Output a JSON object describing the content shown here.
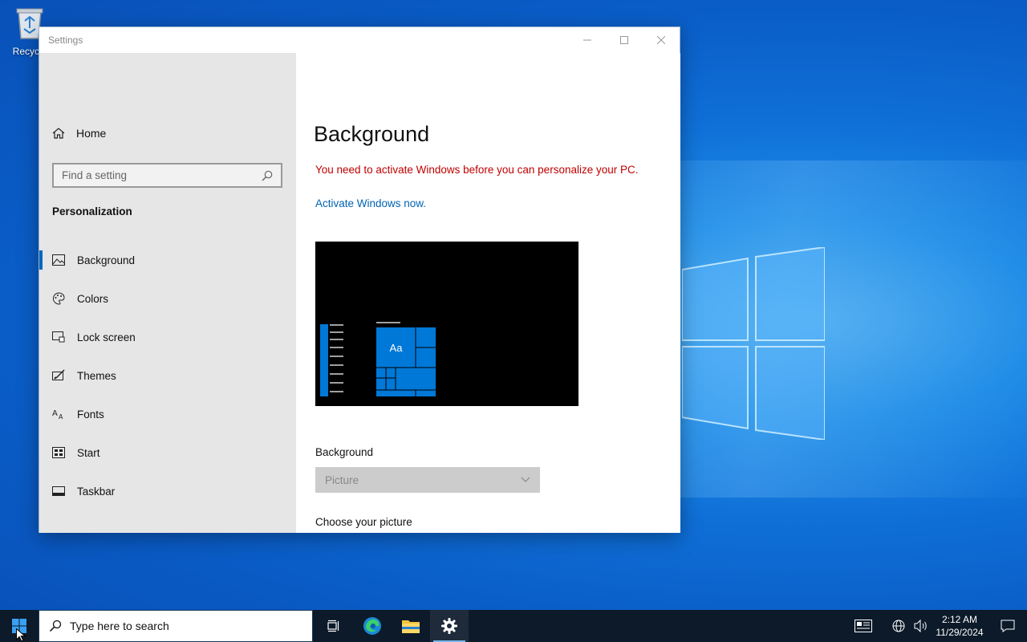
{
  "desktop": {
    "recycle_bin_label": "Recycle"
  },
  "window": {
    "title": "Settings",
    "minimize": "—",
    "maximize": "☐",
    "close": "✕"
  },
  "sidebar": {
    "home_label": "Home",
    "search_placeholder": "Find a setting",
    "section_title": "Personalization",
    "items": [
      {
        "label": "Background",
        "icon": "picture-icon",
        "active": true
      },
      {
        "label": "Colors",
        "icon": "palette-icon"
      },
      {
        "label": "Lock screen",
        "icon": "lock-screen-icon"
      },
      {
        "label": "Themes",
        "icon": "themes-icon"
      },
      {
        "label": "Fonts",
        "icon": "fonts-icon"
      },
      {
        "label": "Start",
        "icon": "start-icon"
      },
      {
        "label": "Taskbar",
        "icon": "taskbar-icon"
      }
    ]
  },
  "main": {
    "heading": "Background",
    "warning": "You need to activate Windows before you can personalize your PC.",
    "activate_link": "Activate Windows now.",
    "preview_tile_text": "Aa",
    "background_label": "Background",
    "background_value": "Picture",
    "choose_label": "Choose your picture"
  },
  "taskbar": {
    "search_placeholder": "Type here to search",
    "time": "2:12 AM",
    "date": "11/29/2024"
  },
  "colors": {
    "accent": "#0067c0",
    "warning": "#c00000",
    "link": "#0063b1",
    "tile_blue": "#0078d7"
  }
}
